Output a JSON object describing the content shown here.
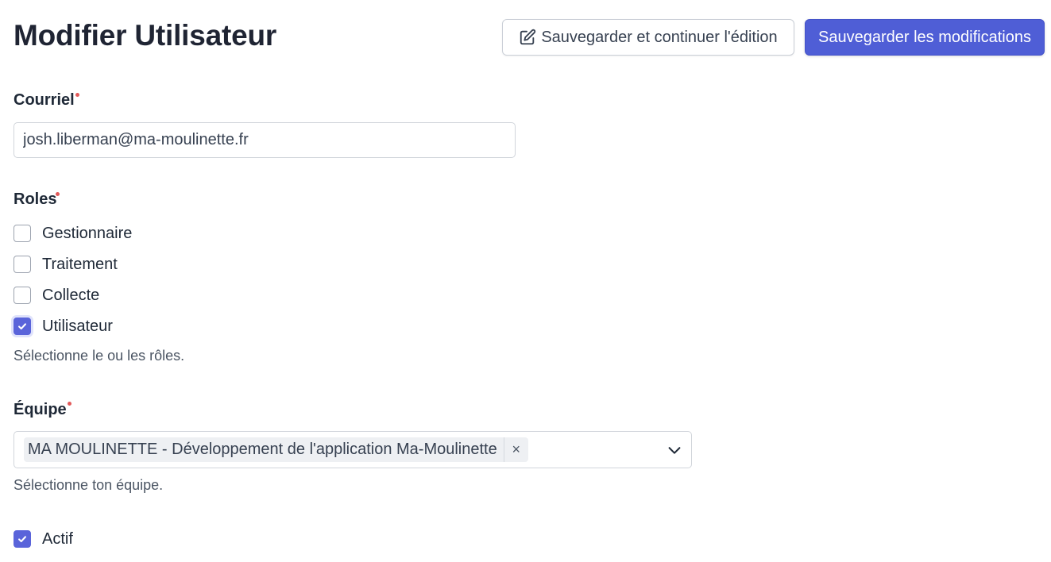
{
  "header": {
    "title": "Modifier Utilisateur",
    "save_continue_label": "Sauvegarder et continuer l'édition",
    "save_label": "Sauvegarder les modifications"
  },
  "form": {
    "email": {
      "label": "Courriel",
      "value": "josh.liberman@ma-moulinette.fr"
    },
    "roles": {
      "label": "Roles",
      "options": [
        {
          "label": "Gestionnaire",
          "checked": false
        },
        {
          "label": "Traitement",
          "checked": false
        },
        {
          "label": "Collecte",
          "checked": false
        },
        {
          "label": "Utilisateur",
          "checked": true
        }
      ],
      "help": "Sélectionne le ou les rôles."
    },
    "team": {
      "label": "Équipe",
      "selected": "MA MOULINETTE - Développement de l'application Ma-Moulinette",
      "remove_symbol": "×",
      "help": "Sélectionne ton équipe."
    },
    "active": {
      "label": "Actif",
      "checked": true
    }
  },
  "colors": {
    "primary": "#4f5ed6",
    "checkbox_checked": "#5a64da",
    "required": "#e25a5a"
  }
}
